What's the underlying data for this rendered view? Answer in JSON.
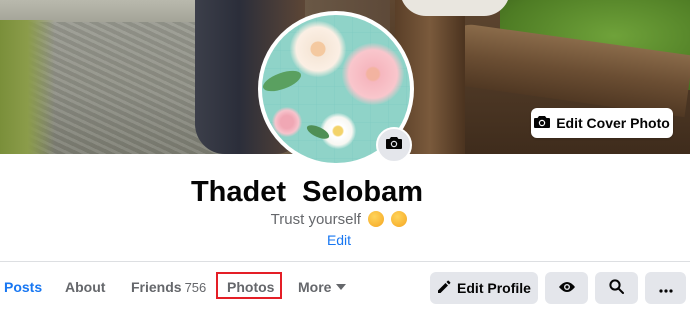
{
  "cover": {
    "edit_cover_label": "Edit Cover Photo",
    "edit_cover_icon": "camera-icon"
  },
  "profile": {
    "name": "Thadet  Selobam",
    "bio": "Trust yourself",
    "bio_emojis": [
      "hugging-face-emoji",
      "hugging-face-emoji"
    ],
    "edit_bio_label": "Edit",
    "avatar_edit_icon": "camera-icon"
  },
  "tabs": [
    {
      "label": "Posts",
      "active": true
    },
    {
      "label": "About"
    },
    {
      "label": "Friends",
      "count": "756"
    },
    {
      "label": "Photos",
      "highlighted": true
    },
    {
      "label": "More",
      "icon": "caret-down-icon"
    }
  ],
  "actions": {
    "edit_profile_label": "Edit Profile",
    "edit_profile_icon": "pencil-icon",
    "view_as_icon": "eye-icon",
    "search_icon": "search-icon",
    "more_icon": "ellipsis-icon"
  },
  "colors": {
    "accent": "#1877f2",
    "highlight_box": "#e41e26",
    "button_bg": "#e4e6eb",
    "muted_text": "#65676b"
  }
}
